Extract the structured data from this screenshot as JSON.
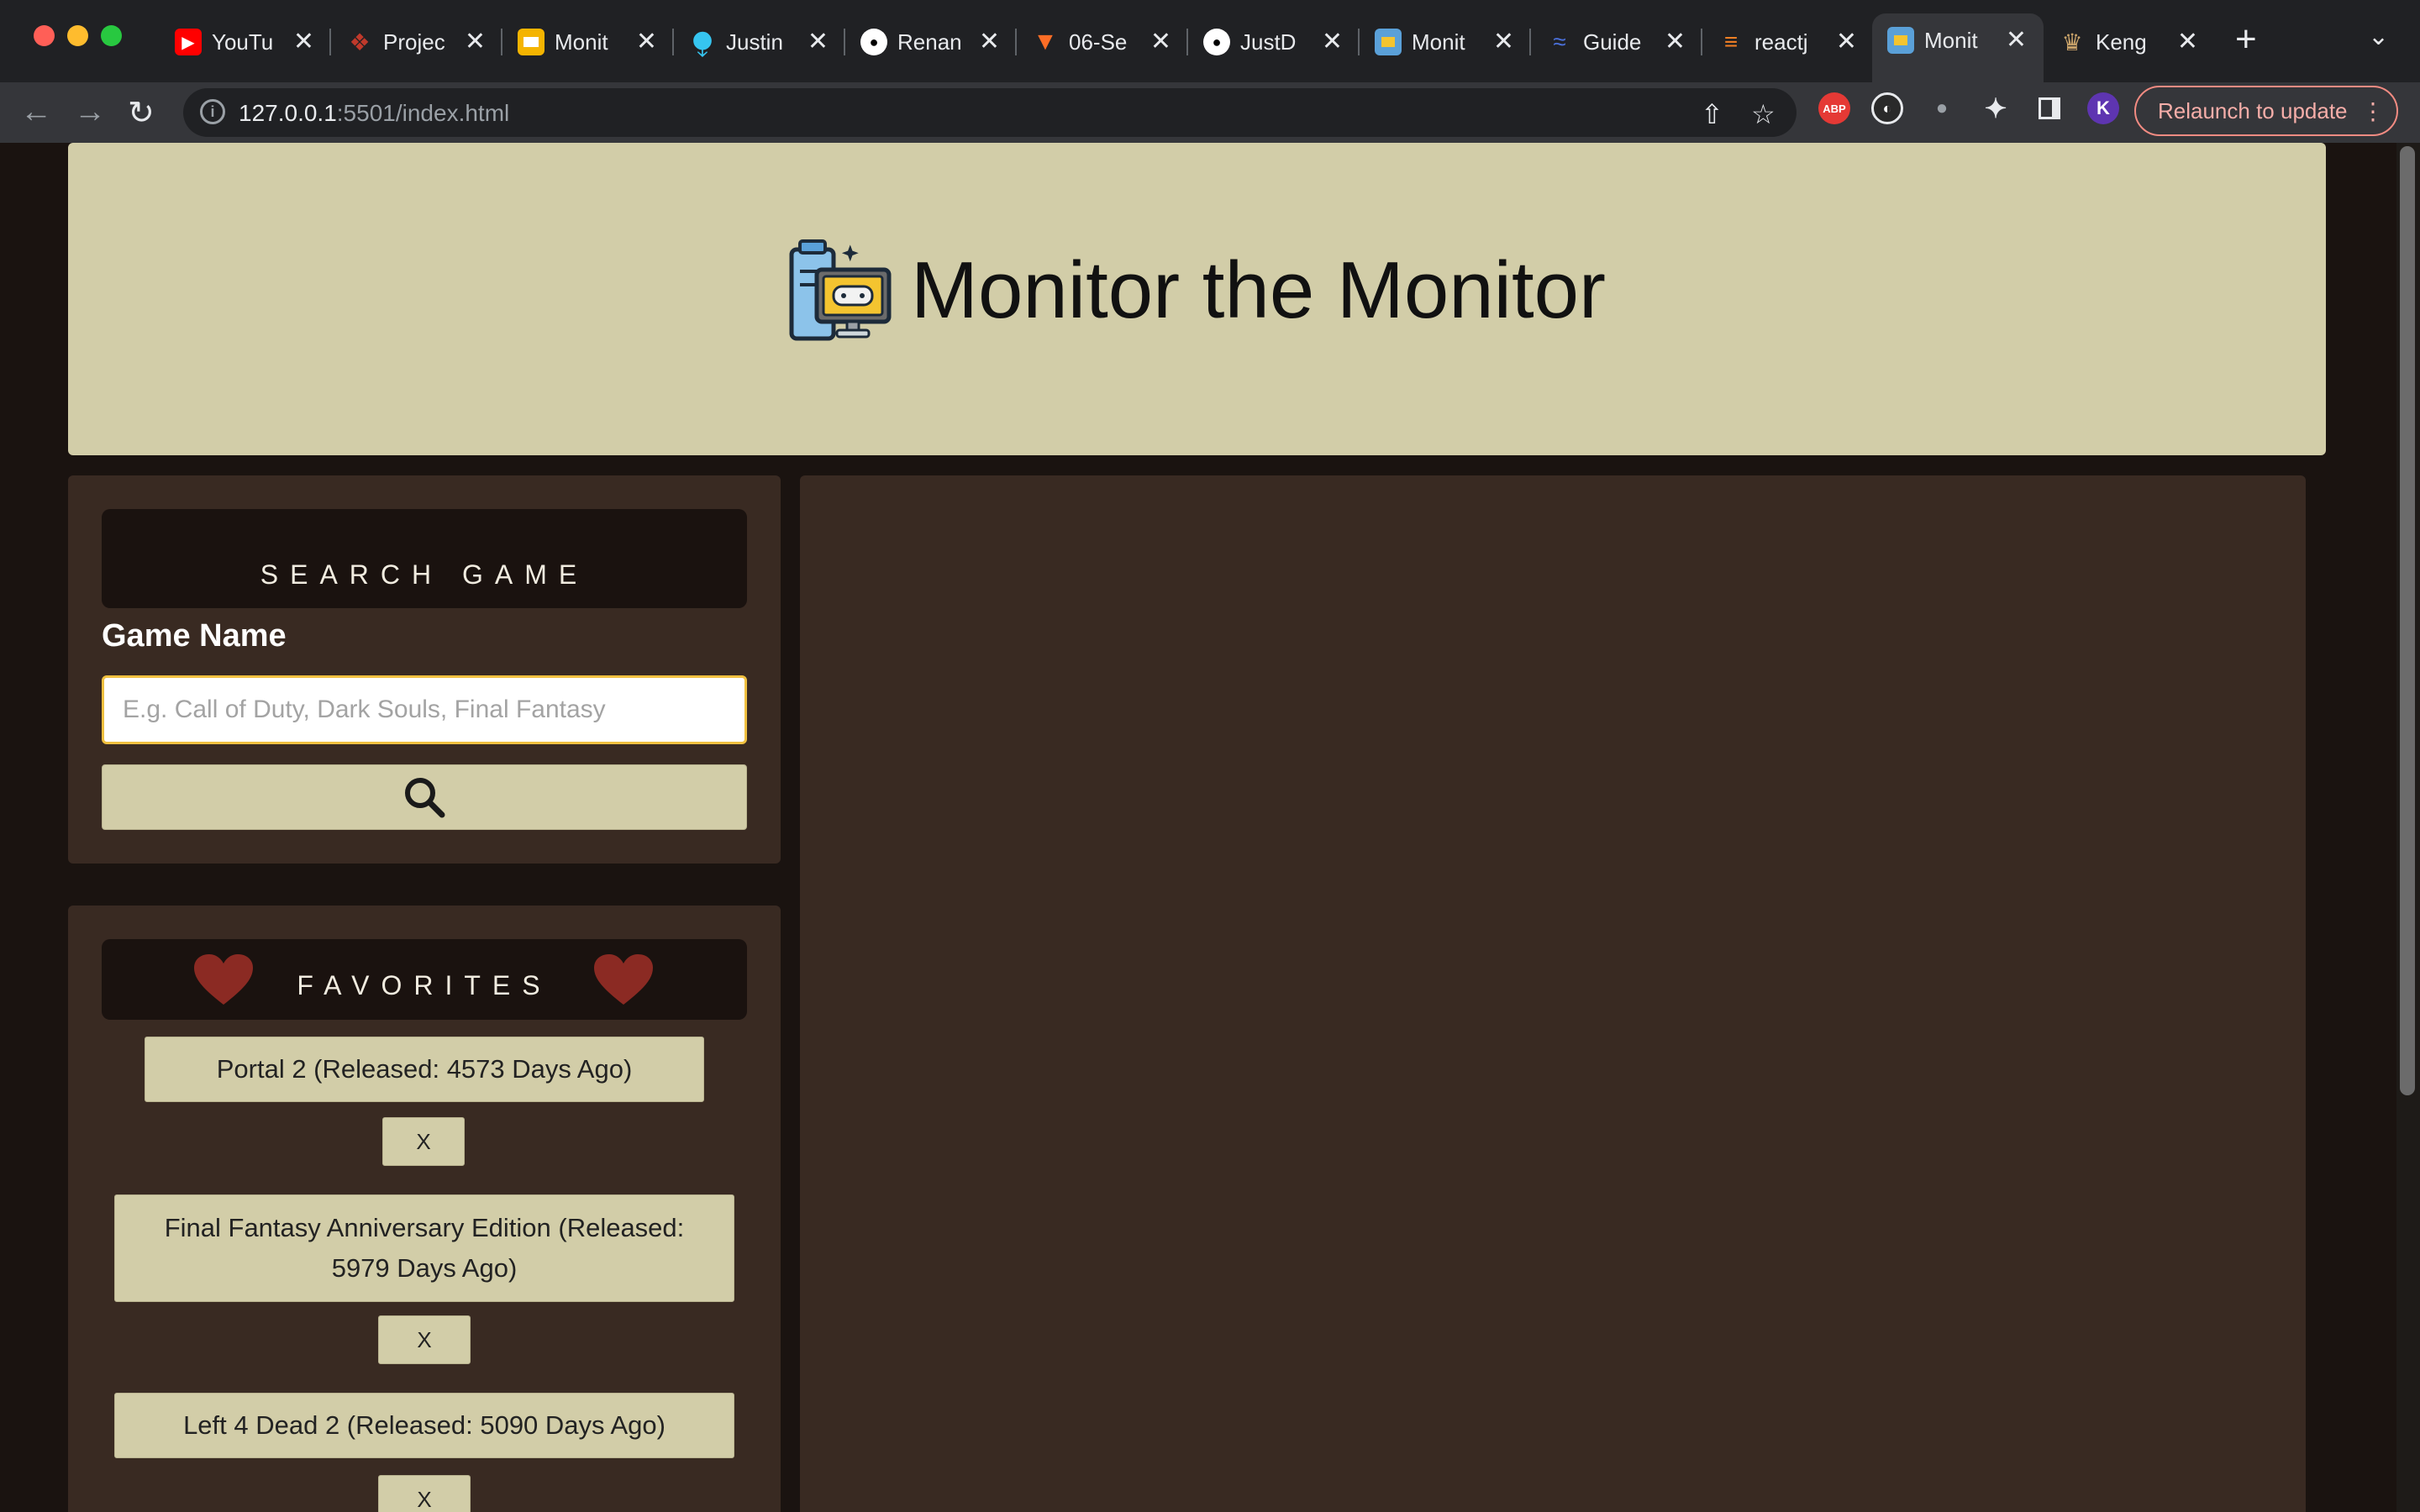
{
  "browser": {
    "tabs": [
      {
        "label": "YouTu",
        "favicon": "youtube-icon",
        "color": "#ff0000"
      },
      {
        "label": "Projec",
        "favicon": "project-icon",
        "color": "#c0392b"
      },
      {
        "label": "Monit",
        "favicon": "slides-icon",
        "color": "#f4b400"
      },
      {
        "label": "Justin",
        "favicon": "slack-icon",
        "color": "#611f69"
      },
      {
        "label": "Renan",
        "favicon": "github-icon",
        "color": "#ffffff"
      },
      {
        "label": "06-Se",
        "favicon": "gitlab-icon",
        "color": "#fc6d26"
      },
      {
        "label": "JustD",
        "favicon": "github-icon",
        "color": "#ffffff"
      },
      {
        "label": "Monit",
        "favicon": "monitor-icon",
        "color": "#5aa0d8"
      },
      {
        "label": "Guide",
        "favicon": "guide-icon",
        "color": "#4a6fd8"
      },
      {
        "label": "reactj",
        "favicon": "stackoverflow-icon",
        "color": "#f48024"
      },
      {
        "label": "Monit",
        "favicon": "monitor-icon",
        "color": "#5aa0d8"
      },
      {
        "label": "Keng",
        "favicon": "keng-icon",
        "color": "#c9a36a"
      }
    ],
    "active_tab_index": 10,
    "url_host": "127.0.0.1",
    "url_rest": ":5501/index.html",
    "relaunch_label": "Relaunch to update",
    "profile_initial": "K",
    "abp_label": "ABP"
  },
  "page": {
    "title": "Monitor the Monitor",
    "search": {
      "heading": "SEARCH GAME",
      "label": "Game Name",
      "placeholder": "E.g. Call of Duty, Dark Souls, Final Fantasy",
      "value": ""
    },
    "favorites": {
      "heading": "FAVORITES",
      "items": [
        {
          "label": "Portal 2 (Released: 4573 Days Ago)",
          "remove": "X"
        },
        {
          "label": "Final Fantasy Anniversary Edition (Released: 5979 Days Ago)",
          "remove": "X"
        },
        {
          "label": "Left 4 Dead 2 (Released: 5090 Days Ago)",
          "remove": "X"
        }
      ]
    }
  },
  "colors": {
    "hero_bg": "#d2cda8",
    "card_bg": "#392a22",
    "page_bg": "#1a1310",
    "heart": "#8b2a23",
    "input_focus": "#f0c040"
  }
}
